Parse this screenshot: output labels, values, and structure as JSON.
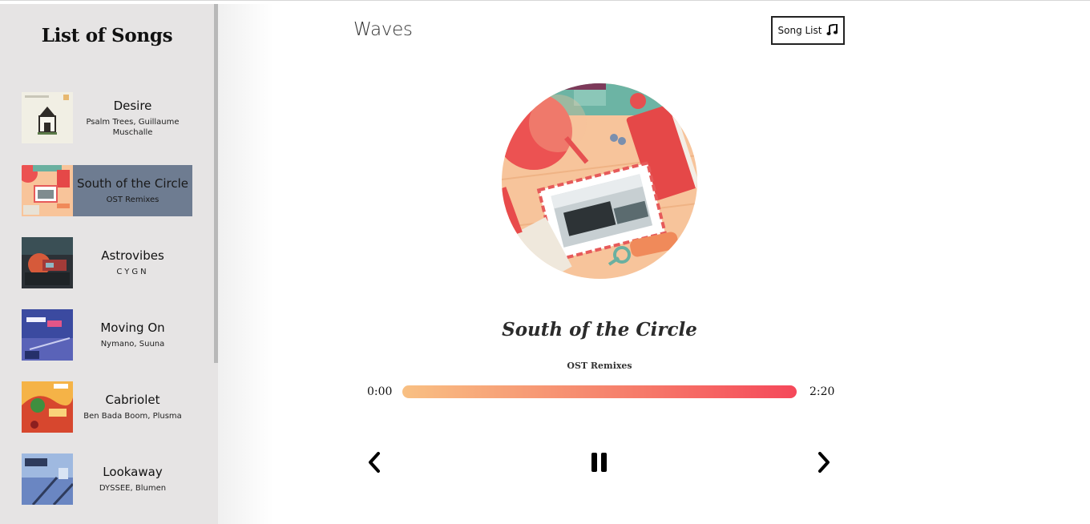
{
  "sidebar": {
    "title": "List of Songs",
    "songs": [
      {
        "name": "Desire",
        "artist": "Psalm Trees, Guillaume Muschalle",
        "active": false
      },
      {
        "name": "South of the Circle",
        "artist": "OST Remixes",
        "active": true
      },
      {
        "name": "Astrovibes",
        "artist": "CYGN",
        "active": false
      },
      {
        "name": "Moving On",
        "artist": "Nymano, Suuna",
        "active": false
      },
      {
        "name": "Cabriolet",
        "artist": "Ben Bada Boom, Plusma",
        "active": false
      },
      {
        "name": "Lookaway",
        "artist": "DYSSEE, Blumen",
        "active": false
      }
    ]
  },
  "header": {
    "app_title": "Waves",
    "song_list_label": "Song List",
    "song_list_icon": "music-note-icon"
  },
  "player": {
    "title": "South of the Circle",
    "artist": "OST Remixes",
    "current_time": "0:00",
    "duration": "2:20",
    "progress": 0.0,
    "controls": {
      "prev_icon": "chevron-left-icon",
      "play_icon": "pause-icon",
      "next_icon": "chevron-right-icon"
    }
  },
  "colors": {
    "sidebar_bg": "#e6e4e4",
    "active_item_bg": "#6e7c91",
    "progress_start": "#f8c083",
    "progress_end": "#f5485a"
  }
}
